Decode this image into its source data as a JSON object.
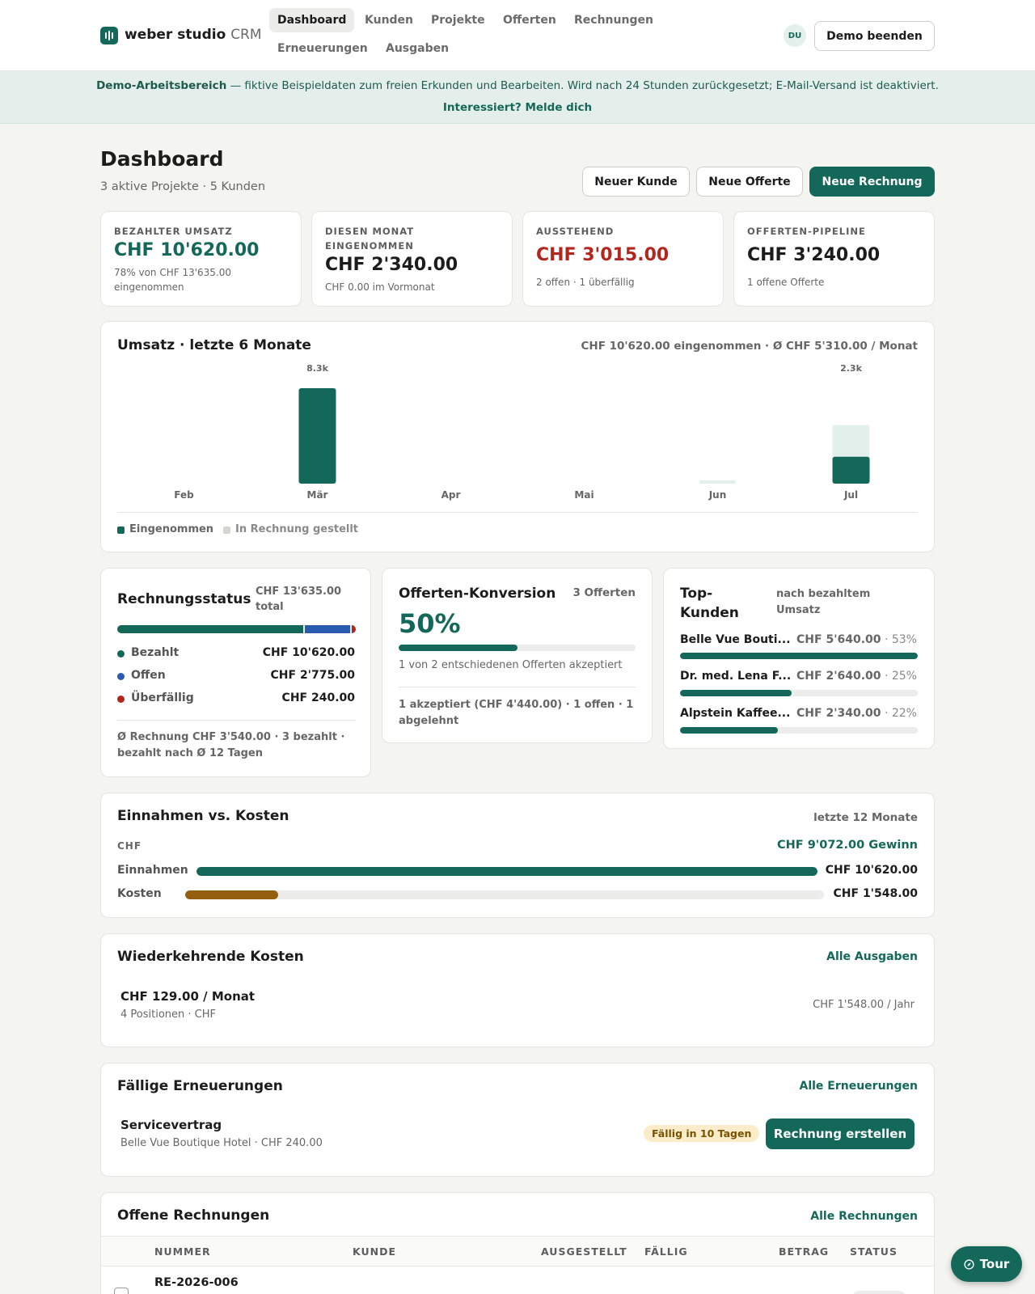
{
  "app": {
    "name": "weber studio",
    "suffix": "CRM"
  },
  "nav": {
    "items": [
      "Dashboard",
      "Kunden",
      "Projekte",
      "Offerten",
      "Rechnungen",
      "Erneuerungen",
      "Ausgaben"
    ],
    "active": "Dashboard"
  },
  "user": {
    "initials": "DU",
    "end_demo": "Demo beenden"
  },
  "banner": {
    "strong": "Demo-Arbeitsbereich",
    "text": " — fiktive Beispieldaten zum freien Erkunden und Bearbeiten. Wird nach 24 Stunden zurückgesetzt; E-Mail-Versand ist deaktiviert.",
    "cta": "Interessiert? Melde dich"
  },
  "page": {
    "title": "Dashboard",
    "subtitle": "3 aktive Projekte · 5 Kunden",
    "actions": {
      "new_customer": "Neuer Kunde",
      "new_offer": "Neue Offerte",
      "new_invoice": "Neue Rechnung"
    }
  },
  "kpis": [
    {
      "label": "BEZAHLTER UMSATZ",
      "value": "CHF 10'620.00",
      "sub": "78% von CHF 13'635.00 eingenommen",
      "color": "#14685a"
    },
    {
      "label": "DIESEN MONAT EINGENOMMEN",
      "value": "CHF 2'340.00",
      "sub": "CHF 0.00 im Vormonat",
      "color": "#1c1c1c"
    },
    {
      "label": "AUSSTEHEND",
      "value": "CHF 3'015.00",
      "sub": "2 offen · 1 überfällig",
      "color": "#b3261e"
    },
    {
      "label": "OFFERTEN-PIPELINE",
      "value": "CHF 3'240.00",
      "sub": "1 offene Offerte",
      "color": "#1c1c1c"
    }
  ],
  "revenue": {
    "title": "Umsatz · letzte 6 Monate",
    "summary": "CHF 10'620.00 eingenommen · Ø CHF 5'310.00 / Monat",
    "legend": {
      "received": "Eingenommen",
      "invoiced": "In Rechnung gestellt"
    }
  },
  "chart_data": {
    "type": "bar",
    "categories": [
      "Feb",
      "Mär",
      "Apr",
      "Mai",
      "Jun",
      "Jul"
    ],
    "series": [
      {
        "name": "Eingenommen",
        "values": [
          0,
          8300,
          0,
          0,
          0,
          2340
        ]
      },
      {
        "name": "In Rechnung gestellt",
        "values": [
          0,
          8300,
          0,
          0,
          240,
          5100
        ]
      }
    ],
    "data_labels": [
      "",
      "8.3k",
      "",
      "",
      "",
      "2.3k"
    ],
    "ylim": [
      0,
      8300
    ],
    "grid": false,
    "legend_position": "bottom-left",
    "colors": {
      "received": "#14685a",
      "invoiced": "#e3efeb"
    }
  },
  "invoice_status": {
    "title": "Rechnungsstatus",
    "total": "CHF 13'635.00 total",
    "rows": [
      {
        "label": "Bezahlt",
        "value": "CHF 10'620.00",
        "color": "#14685a",
        "share": 0.779
      },
      {
        "label": "Offen",
        "value": "CHF 2'775.00",
        "color": "#2b5bb0",
        "share": 0.204
      },
      {
        "label": "Überfällig",
        "value": "CHF 240.00",
        "color": "#b3261e",
        "share": 0.018
      }
    ],
    "footer": "Ø Rechnung CHF 3'540.00 · 3 bezahlt · bezahlt nach Ø 12 Tagen"
  },
  "conversion": {
    "title": "Offerten-Konversion",
    "count": "3 Offerten",
    "rate": "50%",
    "rate_value": 0.5,
    "sub": "1 von 2 entschiedenen Offerten akzeptiert",
    "footer": "1 akzeptiert (CHF 4'440.00) · 1 offen · 1 abgelehnt"
  },
  "top_customers": {
    "title": "Top-Kunden",
    "note": "nach bezahltem Umsatz",
    "rows": [
      {
        "name": "Belle Vue Bouti...",
        "value": "CHF 5'640.00",
        "pct": "· 53%",
        "share": 1.0
      },
      {
        "name": "Dr. med. Lena F...",
        "value": "CHF 2'640.00",
        "pct": "· 25%",
        "share": 0.47
      },
      {
        "name": "Alpstein Kaffee...",
        "value": "CHF 2'340.00",
        "pct": "· 22%",
        "share": 0.41
      }
    ]
  },
  "income_costs": {
    "title": "Einnahmen vs. Kosten",
    "period": "letzte 12 Monate",
    "currency": "CHF",
    "profit": "CHF 9'072.00 Gewinn",
    "income_label": "Einnahmen",
    "income_value": "CHF 10'620.00",
    "income_share": 1.0,
    "cost_label": "Kosten",
    "cost_value": "CHF 1'548.00",
    "cost_share": 0.146,
    "colors": {
      "income": "#14685a",
      "cost": "#94600f"
    }
  },
  "recurring": {
    "title": "Wiederkehrende Kosten",
    "link": "Alle Ausgaben",
    "amount": "CHF 129.00 / Monat",
    "sub": "4 Positionen · CHF",
    "yearly": "CHF 1'548.00 / Jahr"
  },
  "renewals": {
    "title": "Fällige Erneuerungen",
    "link": "Alle Erneuerungen",
    "item": "Servicevertrag",
    "sub": "Belle Vue Boutique Hotel · CHF 240.00",
    "badge": "Fällig in 10 Tagen",
    "action": "Rechnung erstellen"
  },
  "open_invoices": {
    "title": "Offene Rechnungen",
    "link": "Alle Rechnungen",
    "columns": [
      "NUMMER",
      "KUNDE",
      "AUSGESTELLT",
      "FÄLLIG",
      "BETRAG",
      "STATUS"
    ],
    "first_row": "RE-2026-006"
  },
  "tour": {
    "label": "Tour"
  }
}
